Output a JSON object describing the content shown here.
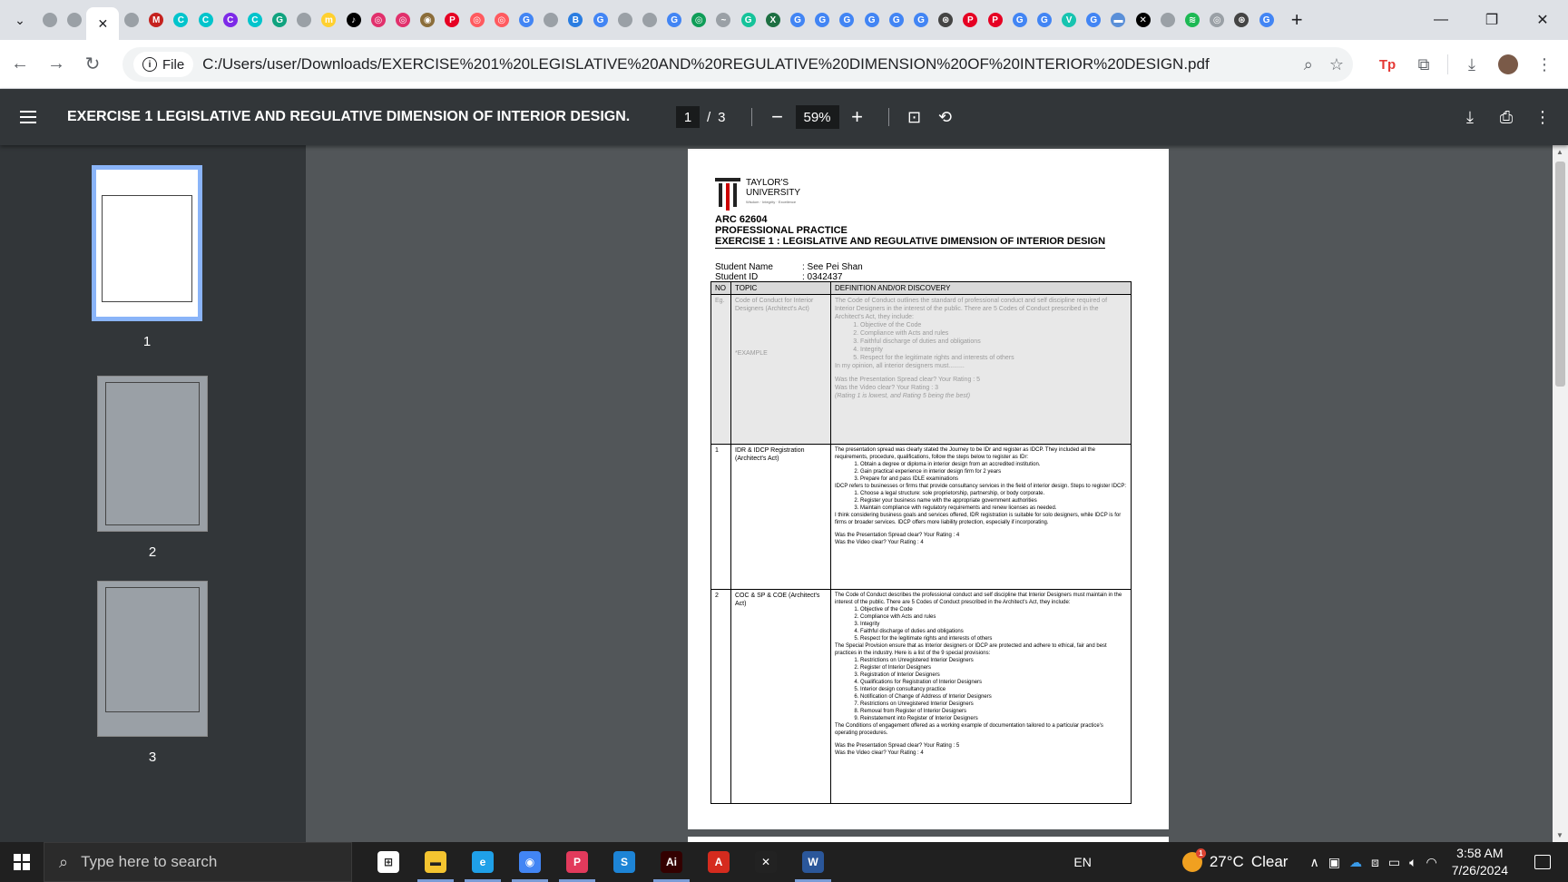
{
  "browser": {
    "tabs": [
      {
        "icon": "globe-icon",
        "color": "#9aa0a6",
        "label": ""
      },
      {
        "icon": "globe-icon",
        "color": "#9aa0a6",
        "label": ""
      },
      {
        "icon": "close-icon",
        "color": "#202124",
        "label": "✕",
        "active": true
      },
      {
        "icon": "globe-icon",
        "color": "#9aa0a6",
        "label": ""
      },
      {
        "icon": "gmail-icon",
        "color": "#c5221f",
        "label": "M"
      },
      {
        "icon": "canva-icon",
        "color": "#00c4cc",
        "label": "C"
      },
      {
        "icon": "canva-icon",
        "color": "#00c4cc",
        "label": "C"
      },
      {
        "icon": "canva-icon",
        "color": "#7d2ae8",
        "label": "C"
      },
      {
        "icon": "canva-icon",
        "color": "#00c4cc",
        "label": "C"
      },
      {
        "icon": "chatgpt-icon",
        "color": "#10a37f",
        "label": "G"
      },
      {
        "icon": "globe-icon",
        "color": "#9aa0a6",
        "label": ""
      },
      {
        "icon": "miro-icon",
        "color": "#ffd02f",
        "label": "m"
      },
      {
        "icon": "tiktok-icon",
        "color": "#000000",
        "label": "♪"
      },
      {
        "icon": "instagram-icon",
        "color": "#e1306c",
        "label": "◎"
      },
      {
        "icon": "instagram-icon",
        "color": "#e1306c",
        "label": "◎"
      },
      {
        "icon": "app-icon",
        "color": "#8b6d3a",
        "label": "◉"
      },
      {
        "icon": "pinterest-icon",
        "color": "#e60023",
        "label": "P"
      },
      {
        "icon": "app-icon",
        "color": "#ff5a5f",
        "label": "◎"
      },
      {
        "icon": "app-icon",
        "color": "#ff5a5f",
        "label": "◎"
      },
      {
        "icon": "google-icon",
        "color": "#4285f4",
        "label": "G"
      },
      {
        "icon": "globe-icon",
        "color": "#9aa0a6",
        "label": ""
      },
      {
        "icon": "book-icon",
        "color": "#2a7de1",
        "label": "B"
      },
      {
        "icon": "google-icon",
        "color": "#4285f4",
        "label": "G"
      },
      {
        "icon": "globe-icon",
        "color": "#9aa0a6",
        "label": ""
      },
      {
        "icon": "globe-icon",
        "color": "#9aa0a6",
        "label": ""
      },
      {
        "icon": "google-icon",
        "color": "#4285f4",
        "label": "G"
      },
      {
        "icon": "app-icon",
        "color": "#0f9d58",
        "label": "◎"
      },
      {
        "icon": "app-icon",
        "color": "#9aa0a6",
        "label": "~"
      },
      {
        "icon": "grammarly-icon",
        "color": "#15c39a",
        "label": "G"
      },
      {
        "icon": "excel-icon",
        "color": "#1d6f42",
        "label": "X"
      },
      {
        "icon": "google-icon",
        "color": "#4285f4",
        "label": "G"
      },
      {
        "icon": "google-icon",
        "color": "#4285f4",
        "label": "G"
      },
      {
        "icon": "google-icon",
        "color": "#4285f4",
        "label": "G"
      },
      {
        "icon": "google-icon",
        "color": "#4285f4",
        "label": "G"
      },
      {
        "icon": "google-icon",
        "color": "#4285f4",
        "label": "G"
      },
      {
        "icon": "google-icon",
        "color": "#4285f4",
        "label": "G"
      },
      {
        "icon": "chatgpt-icon",
        "color": "#444444",
        "label": "⊛"
      },
      {
        "icon": "pinterest-icon",
        "color": "#e60023",
        "label": "P"
      },
      {
        "icon": "pinterest-icon",
        "color": "#e60023",
        "label": "P"
      },
      {
        "icon": "google-icon",
        "color": "#4285f4",
        "label": "G"
      },
      {
        "icon": "google-icon",
        "color": "#4285f4",
        "label": "G"
      },
      {
        "icon": "vectary-icon",
        "color": "#17c4b0",
        "label": "V"
      },
      {
        "icon": "google-icon",
        "color": "#4285f4",
        "label": "G"
      },
      {
        "icon": "app-icon",
        "color": "#5a8fd8",
        "label": "▬"
      },
      {
        "icon": "capcut-icon",
        "color": "#000000",
        "label": "✕"
      },
      {
        "icon": "globe-icon",
        "color": "#9aa0a6",
        "label": ""
      },
      {
        "icon": "spotify-icon",
        "color": "#1db954",
        "label": "≋"
      },
      {
        "icon": "app-icon",
        "color": "#9aa0a6",
        "label": "◎"
      },
      {
        "icon": "chatgpt-icon",
        "color": "#444444",
        "label": "⊛"
      },
      {
        "icon": "google-icon",
        "color": "#4285f4",
        "label": "G"
      }
    ],
    "new_tab": "+",
    "site_chip": "File",
    "url": "C:/Users/user/Downloads/EXERCISE%201%20LEGISLATIVE%20AND%20REGULATIVE%20DIMENSION%20OF%20INTERIOR%20DESIGN.pdf"
  },
  "pdf": {
    "title": "EXERCISE 1 LEGISLATIVE AND REGULATIVE DIMENSION OF INTERIOR DESIGN.pdf",
    "current_page": "1",
    "page_sep": "/",
    "total_pages": "3",
    "zoom": "59%",
    "thumbnails": [
      "1",
      "2",
      "3"
    ]
  },
  "document": {
    "logo_line1": "TAYLOR'S",
    "logo_line2": "UNIVERSITY",
    "logo_tag": "Wisdom · Integrity · Excellence",
    "course_code": "ARC 62604",
    "course_name": "PROFESSIONAL PRACTICE",
    "exercise": "EXERCISE 1 : LEGISLATIVE AND REGULATIVE DIMENSION OF INTERIOR DESIGN",
    "student_name_label": "Student Name",
    "student_name": ": See Pei Shan",
    "student_id_label": "Student ID",
    "student_id": ": 0342437",
    "table_head": [
      "NO",
      "TOPIC",
      "DEFINITION AND/OR DISCOVERY"
    ],
    "eg": {
      "no": "Eg.",
      "topic": "Code of Conduct for Interior Designers (Architect's Act)",
      "topic_note": "*EXAMPLE",
      "intro": "The Code of Conduct outlines the standard of professional conduct and self discipline required of Interior Designers in the interest of the public. There are 5 Codes of Conduct prescribed in the Architect's Act, they include:",
      "items": [
        "Objective of the Code",
        "Compliance with Acts and rules",
        "Faithful discharge of duties and obligations",
        "Integrity",
        "Respect for the legitimate rights and interests of others"
      ],
      "opinion": "In my opinion, all interior designers must.........",
      "q1": "Was the Presentation Spread clear? Your Rating : 5",
      "q2": "Was the Video clear? Your Rating : 3",
      "note": "(Rating 1 is lowest, and Rating 5 being the best)"
    },
    "row1": {
      "no": "1",
      "topic": "IDR & IDCP Registration (Architect's Act)",
      "intro": "The presentation spread was clearly stated the Journey to be IDr and register as IDCP. They included all the requirements, procedure, qualifications, follow the steps below to register as IDr:",
      "steps_a": [
        "Obtain a degree or diploma in interior design from an accredited institution.",
        "Gain practical experience in interior design firm for 2 years",
        "Prepare for and pass IDLE examinations"
      ],
      "idcp": "IDCP refers to businesses or firms that provide consultancy services in the field of interior design. Steps to register IDCP:",
      "steps_b": [
        "Choose a legal structure: sole proprietorship, partnership, or body corporate.",
        "Register your business name with the appropriate government authorities",
        "Maintain compliance with regulatory requirements and renew licenses as needed."
      ],
      "opinion": "I think considering business goals and services offered, IDR registration is suitable for solo designers, while IDCP is for firms or broader services. IDCP offers more liability protection, especially if incorporating.",
      "q1": "Was the Presentation Spread clear? Your Rating : 4",
      "q2": "Was the Video clear? Your Rating : 4"
    },
    "row2": {
      "no": "2",
      "topic": "COC & SP & COE (Architect's Act)",
      "intro": "The Code of Conduct describes the professional conduct and self discipline that Interior Designers must maintain in the interest of the public. There are 5 Codes of Conduct prescribed in the Architect's Act, they include:",
      "items_a": [
        "Objective of the Code",
        "Compliance with Acts and rules",
        "Integrity",
        "Faithful discharge of duties and obligations",
        "Respect for the legitimate rights and interests of others"
      ],
      "sp": "The Special Provision ensure that as Interior designers or IDCP are protected and adhere to ethical, fair and best practices in the industry. Here is a list of the 9 special provisions:",
      "items_b": [
        "Restrictions on Unregistered Interior Designers",
        "Register of Interior Designers",
        "Registration of Interior Designers",
        "Qualifications for Registration of Interior Designers",
        "Interior design consultancy practice",
        "Notification of Change of Address of Interior Designers",
        "Restrictions on Unregistered Interior Designers",
        "Removal from Register of Interior Designers",
        "Reinstatement into Register of Interior Designers"
      ],
      "coe": "The Conditions of engagement offered as a working example of documentation tailored to a particular practice's operating procedures.",
      "q1": "Was the Presentation Spread clear? Your Rating : 5",
      "q2": "Was the Video clear? Your Rating : 4"
    }
  },
  "taskbar": {
    "search_placeholder": "Type here to search",
    "apps": [
      {
        "icon": "task-view-icon",
        "color": "#ffffff",
        "label": "⊞"
      },
      {
        "icon": "file-explorer-icon",
        "color": "#f4c430",
        "label": "▬",
        "open": true
      },
      {
        "icon": "edge-icon",
        "color": "#1fa0e8",
        "label": "e",
        "open": true
      },
      {
        "icon": "chrome-icon",
        "color": "#4285f4",
        "label": "◉",
        "open": true
      },
      {
        "icon": "app-icon",
        "color": "#e23a5c",
        "label": "P",
        "open": true
      },
      {
        "icon": "sketchup-icon",
        "color": "#1d84d6",
        "label": "S"
      },
      {
        "icon": "illustrator-icon",
        "color": "#330000",
        "label": "Ai",
        "open": true
      },
      {
        "icon": "acrobat-icon",
        "color": "#d52b1e",
        "label": "A"
      },
      {
        "icon": "capcut-icon",
        "color": "#222222",
        "label": "✕"
      },
      {
        "icon": "word-icon",
        "color": "#2b579a",
        "label": "W",
        "open": true
      }
    ],
    "lang": "EN",
    "temperature": "27°C",
    "weather": "Clear",
    "weather_badge": "1",
    "time": "3:58 AM",
    "date": "7/26/2024"
  }
}
